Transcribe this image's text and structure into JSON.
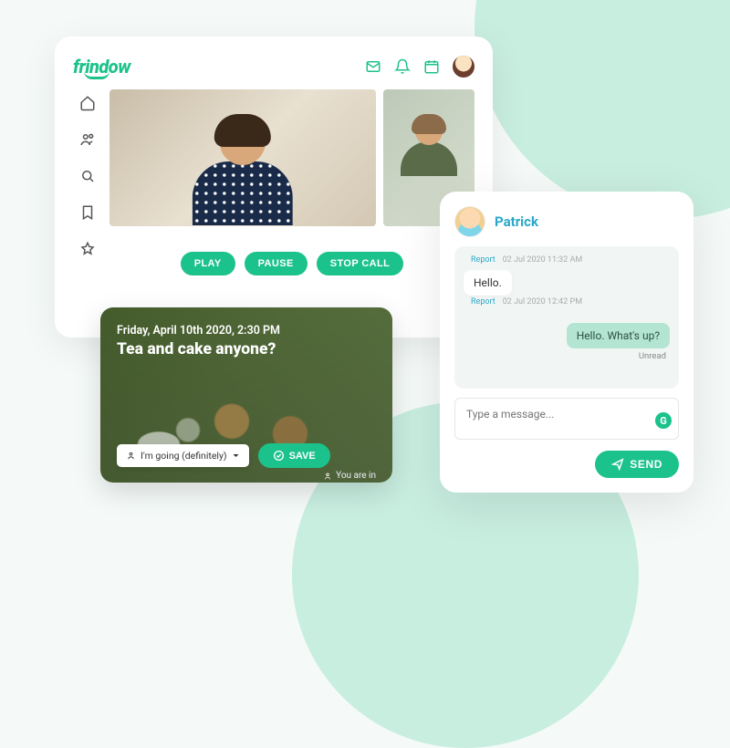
{
  "brand": {
    "logo_text": "frindow"
  },
  "call": {
    "buttons": {
      "play": "PLAY",
      "pause": "PAUSE",
      "stop": "STOP CALL"
    }
  },
  "event": {
    "datetime": "Friday, April 10th 2020, 2:30 PM",
    "title": "Tea and cake anyone?",
    "rsvp_selected": "I'm going (definitely)",
    "save_label": "SAVE",
    "status": "You are in"
  },
  "chat": {
    "contact_name": "Patrick",
    "messages": [
      {
        "report_label": "Report",
        "timestamp": "02 Jul 2020 11:32 AM"
      },
      {
        "text": "Hello.",
        "report_label": "Report",
        "timestamp": "02 Jul 2020 12:42 PM"
      }
    ],
    "outgoing": {
      "text": "Hello. What's up?",
      "status": "Unread"
    },
    "input_placeholder": "Type a message...",
    "send_label": "SEND",
    "badge_letter": "G"
  }
}
